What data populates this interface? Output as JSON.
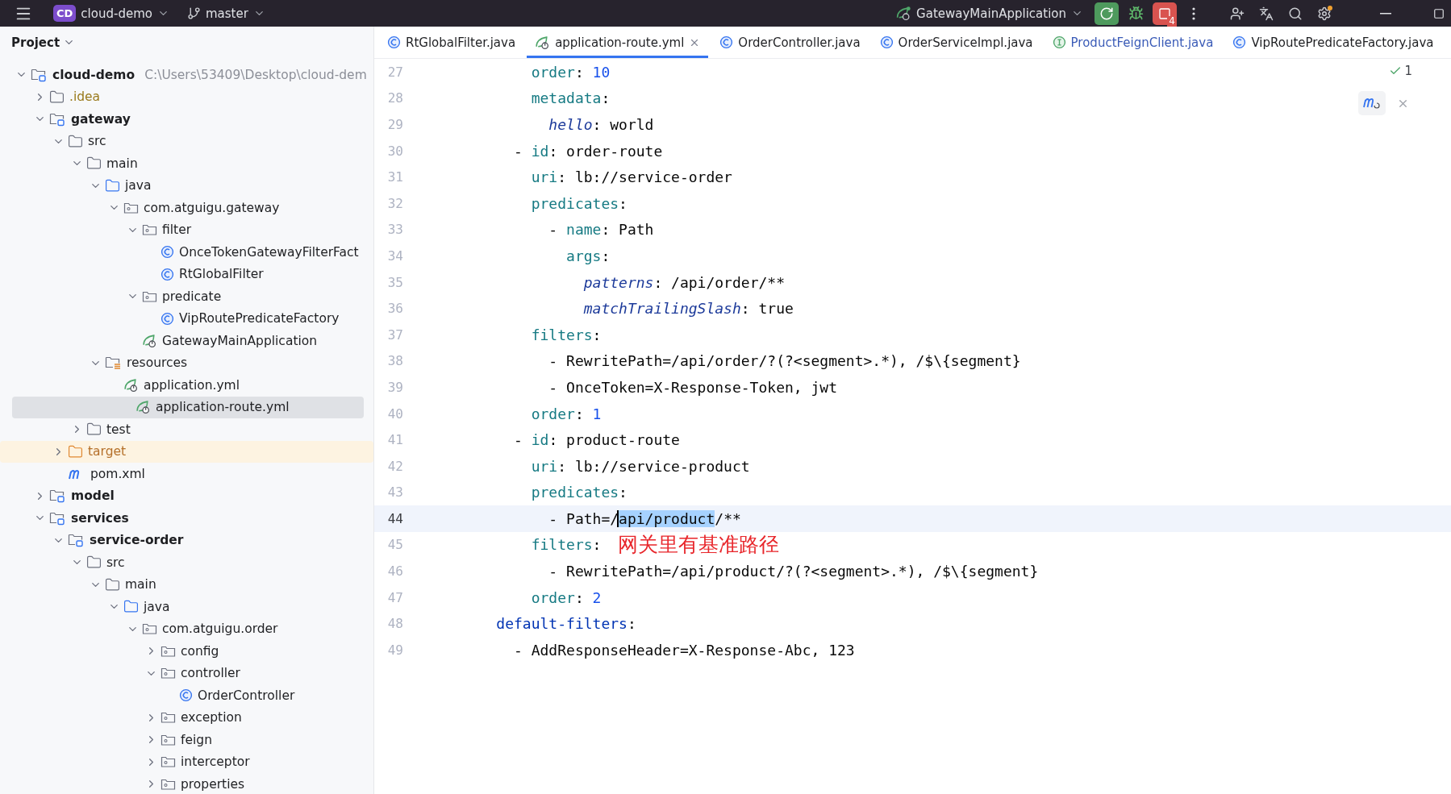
{
  "title_bar": {
    "project": {
      "badge": "CD",
      "name": "cloud-demo"
    },
    "branch": "master",
    "run_config": "GatewayMainApplication",
    "stop_count": "4"
  },
  "project_panel": {
    "title": "Project",
    "tree": [
      {
        "label": "cloud-demo",
        "kind": "module",
        "expanded": true,
        "selected": false,
        "note": "C:\\Users\\53409\\Desktop\\cloud-dem",
        "children": [
          {
            "label": ".idea",
            "kind": "ignored-folder",
            "expanded": false,
            "selected": false
          },
          {
            "label": "gateway",
            "kind": "module",
            "expanded": true,
            "selected": false,
            "children": [
              {
                "label": "src",
                "kind": "folder",
                "expanded": true,
                "selected": false,
                "children": [
                  {
                    "label": "main",
                    "kind": "folder",
                    "expanded": true,
                    "selected": false,
                    "children": [
                      {
                        "label": "java",
                        "kind": "source-folder",
                        "expanded": true,
                        "selected": false,
                        "children": [
                          {
                            "label": "com.atguigu.gateway",
                            "kind": "package",
                            "expanded": true,
                            "selected": false,
                            "children": [
                              {
                                "label": "filter",
                                "kind": "package",
                                "expanded": true,
                                "selected": false,
                                "children": [
                                  {
                                    "label": "OnceTokenGatewayFilterFact",
                                    "kind": "class",
                                    "selected": false
                                  },
                                  {
                                    "label": "RtGlobalFilter",
                                    "kind": "class",
                                    "selected": false
                                  }
                                ]
                              },
                              {
                                "label": "predicate",
                                "kind": "package",
                                "expanded": true,
                                "selected": false,
                                "children": [
                                  {
                                    "label": "VipRoutePredicateFactory",
                                    "kind": "class",
                                    "selected": false
                                  }
                                ]
                              },
                              {
                                "label": "GatewayMainApplication",
                                "kind": "spring-class",
                                "selected": false
                              }
                            ]
                          }
                        ]
                      },
                      {
                        "label": "resources",
                        "kind": "resources-folder",
                        "expanded": true,
                        "selected": false,
                        "children": [
                          {
                            "label": "application.yml",
                            "kind": "yaml",
                            "selected": false
                          },
                          {
                            "label": "application-route.yml",
                            "kind": "yaml",
                            "selected": true
                          }
                        ]
                      }
                    ]
                  },
                  {
                    "label": "test",
                    "kind": "folder",
                    "expanded": false,
                    "selected": false
                  }
                ]
              },
              {
                "label": "target",
                "kind": "excluded-folder",
                "expanded": false,
                "selected": false
              },
              {
                "label": "pom.xml",
                "kind": "maven",
                "selected": false
              }
            ]
          },
          {
            "label": "model",
            "kind": "module",
            "expanded": false,
            "selected": false
          },
          {
            "label": "services",
            "kind": "module",
            "expanded": true,
            "selected": false,
            "children": [
              {
                "label": "service-order",
                "kind": "module",
                "expanded": true,
                "selected": false,
                "children": [
                  {
                    "label": "src",
                    "kind": "folder",
                    "expanded": true,
                    "selected": false,
                    "children": [
                      {
                        "label": "main",
                        "kind": "folder",
                        "expanded": true,
                        "selected": false,
                        "children": [
                          {
                            "label": "java",
                            "kind": "source-folder",
                            "expanded": true,
                            "selected": false,
                            "children": [
                              {
                                "label": "com.atguigu.order",
                                "kind": "package",
                                "expanded": true,
                                "selected": false,
                                "children": [
                                  {
                                    "label": "config",
                                    "kind": "package",
                                    "expanded": false,
                                    "selected": false
                                  },
                                  {
                                    "label": "controller",
                                    "kind": "package",
                                    "expanded": true,
                                    "selected": false,
                                    "children": [
                                      {
                                        "label": "OrderController",
                                        "kind": "class",
                                        "selected": false
                                      }
                                    ]
                                  },
                                  {
                                    "label": "exception",
                                    "kind": "package",
                                    "expanded": false,
                                    "selected": false
                                  },
                                  {
                                    "label": "feign",
                                    "kind": "package",
                                    "expanded": false,
                                    "selected": false
                                  },
                                  {
                                    "label": "interceptor",
                                    "kind": "package",
                                    "expanded": false,
                                    "selected": false
                                  },
                                  {
                                    "label": "properties",
                                    "kind": "package",
                                    "expanded": false,
                                    "selected": false
                                  }
                                ]
                              }
                            ]
                          }
                        ]
                      }
                    ]
                  }
                ]
              }
            ]
          }
        ]
      }
    ]
  },
  "tabs": [
    {
      "label": "RtGlobalFilter.java",
      "kind": "class",
      "selected": false,
      "modified": false
    },
    {
      "label": "application-route.yml",
      "kind": "yaml",
      "selected": true,
      "modified": false
    },
    {
      "label": "OrderController.java",
      "kind": "class",
      "selected": false,
      "modified": false
    },
    {
      "label": "OrderServiceImpl.java",
      "kind": "class",
      "selected": false,
      "modified": false
    },
    {
      "label": "ProductFeignClient.java",
      "kind": "interface",
      "selected": false,
      "modified": true
    },
    {
      "label": "VipRoutePredicateFactory.java",
      "kind": "class",
      "selected": false,
      "modified": false
    }
  ],
  "editor": {
    "problems": "1",
    "lines": [
      {
        "number": "27",
        "current": false,
        "tokens": [
          {
            "kind": "key",
            "text": "        order"
          },
          {
            "kind": "plain",
            "text": ": "
          },
          {
            "kind": "number",
            "text": "10"
          }
        ]
      },
      {
        "number": "28",
        "current": false,
        "tokens": [
          {
            "kind": "key",
            "text": "        metadata"
          },
          {
            "kind": "plain",
            "text": ":"
          }
        ]
      },
      {
        "number": "29",
        "current": false,
        "tokens": [
          {
            "kind": "subkey",
            "text": "          hello"
          },
          {
            "kind": "plain",
            "text": ": world"
          }
        ]
      },
      {
        "number": "30",
        "current": false,
        "tokens": [
          {
            "kind": "plain",
            "text": "      - "
          },
          {
            "kind": "key",
            "text": "id"
          },
          {
            "kind": "plain",
            "text": ": order-route"
          }
        ]
      },
      {
        "number": "31",
        "current": false,
        "tokens": [
          {
            "kind": "key",
            "text": "        uri"
          },
          {
            "kind": "plain",
            "text": ": lb://service-order"
          }
        ]
      },
      {
        "number": "32",
        "current": false,
        "tokens": [
          {
            "kind": "key",
            "text": "        predicates"
          },
          {
            "kind": "plain",
            "text": ":"
          }
        ]
      },
      {
        "number": "33",
        "current": false,
        "tokens": [
          {
            "kind": "plain",
            "text": "          - "
          },
          {
            "kind": "key",
            "text": "name"
          },
          {
            "kind": "plain",
            "text": ": Path"
          }
        ]
      },
      {
        "number": "34",
        "current": false,
        "tokens": [
          {
            "kind": "key",
            "text": "            args"
          },
          {
            "kind": "plain",
            "text": ":"
          }
        ]
      },
      {
        "number": "35",
        "current": false,
        "tokens": [
          {
            "kind": "subkey",
            "text": "              patterns"
          },
          {
            "kind": "plain",
            "text": ": /api/order/**"
          }
        ]
      },
      {
        "number": "36",
        "current": false,
        "tokens": [
          {
            "kind": "subkey",
            "text": "              matchTrailingSlash"
          },
          {
            "kind": "plain",
            "text": ": true"
          }
        ]
      },
      {
        "number": "37",
        "current": false,
        "tokens": [
          {
            "kind": "key",
            "text": "        filters"
          },
          {
            "kind": "plain",
            "text": ":"
          }
        ]
      },
      {
        "number": "38",
        "current": false,
        "tokens": [
          {
            "kind": "plain",
            "text": "          - RewritePath=/api/order/?(?<segment>.*), /$\\{segment}"
          }
        ]
      },
      {
        "number": "39",
        "current": false,
        "tokens": [
          {
            "kind": "plain",
            "text": "          - OnceToken=X-Response-Token, jwt"
          }
        ]
      },
      {
        "number": "40",
        "current": false,
        "tokens": [
          {
            "kind": "key",
            "text": "        order"
          },
          {
            "kind": "plain",
            "text": ": "
          },
          {
            "kind": "number",
            "text": "1"
          }
        ]
      },
      {
        "number": "41",
        "current": false,
        "tokens": [
          {
            "kind": "plain",
            "text": "      - "
          },
          {
            "kind": "key",
            "text": "id"
          },
          {
            "kind": "plain",
            "text": ": product-route"
          }
        ]
      },
      {
        "number": "42",
        "current": false,
        "tokens": [
          {
            "kind": "key",
            "text": "        uri"
          },
          {
            "kind": "plain",
            "text": ": lb://service-product"
          }
        ]
      },
      {
        "number": "43",
        "current": false,
        "tokens": [
          {
            "kind": "key",
            "text": "        predicates"
          },
          {
            "kind": "plain",
            "text": ":"
          }
        ]
      },
      {
        "number": "44",
        "current": true,
        "tokens": [
          {
            "kind": "plain",
            "text": "          - Path=/"
          },
          {
            "kind": "selection",
            "text": "api/product"
          },
          {
            "kind": "plain",
            "text": "/**"
          }
        ]
      },
      {
        "number": "45",
        "current": false,
        "annotation": "网关里有基准路径",
        "tokens": [
          {
            "kind": "key",
            "text": "        filters"
          },
          {
            "kind": "plain",
            "text": ":"
          }
        ]
      },
      {
        "number": "46",
        "current": false,
        "tokens": [
          {
            "kind": "plain",
            "text": "          - RewritePath=/api/product/?(?<segment>.*), /$\\{segment}"
          }
        ]
      },
      {
        "number": "47",
        "current": false,
        "tokens": [
          {
            "kind": "key",
            "text": "        order"
          },
          {
            "kind": "plain",
            "text": ": "
          },
          {
            "kind": "number",
            "text": "2"
          }
        ]
      },
      {
        "number": "48",
        "current": false,
        "tokens": [
          {
            "kind": "top",
            "text": "    default-filters"
          },
          {
            "kind": "plain",
            "text": ":"
          }
        ]
      },
      {
        "number": "49",
        "current": false,
        "tokens": [
          {
            "kind": "plain",
            "text": "      - AddResponseHeader=X-Response-Abc, 123"
          }
        ]
      }
    ]
  }
}
